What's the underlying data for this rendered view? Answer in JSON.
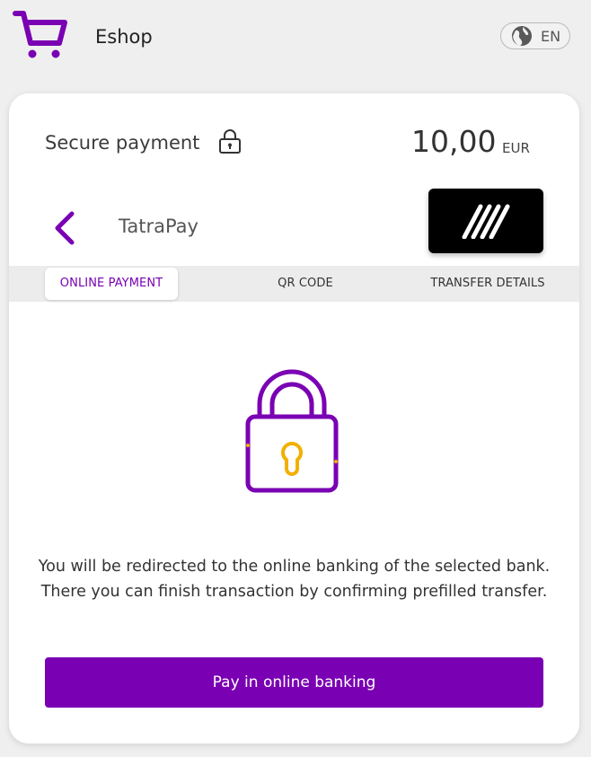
{
  "header": {
    "shop_name": "Eshop",
    "language": "EN",
    "icons": {
      "cart": "shopping-cart-icon",
      "globe": "globe-icon"
    }
  },
  "payment": {
    "title": "Secure payment",
    "amount": "10,00",
    "currency": "EUR",
    "icons": {
      "lock": "lock-icon"
    }
  },
  "bank": {
    "name": "TatraPay",
    "icons": {
      "back": "chevron-left-icon",
      "logo": "tatra-banka-logo"
    }
  },
  "tabs": [
    {
      "label": "ONLINE PAYMENT",
      "active": true
    },
    {
      "label": "QR CODE",
      "active": false
    },
    {
      "label": "TRANSFER DETAILS",
      "active": false
    }
  ],
  "content": {
    "message": "You will be redirected to the online banking of the selected bank. There you can finish transaction by confirming prefilled transfer.",
    "button_label": "Pay in online banking"
  },
  "colors": {
    "accent": "#7a00b3",
    "lock_key": "#f2b000",
    "background": "#efefef"
  }
}
